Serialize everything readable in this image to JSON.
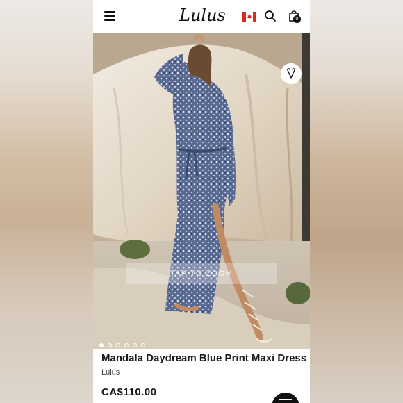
{
  "header": {
    "logo_text": "Lulus",
    "cart_count": "0",
    "icons": [
      "hamburger-menu-icon",
      "canada-flag-icon",
      "search-icon",
      "shopping-bag-icon"
    ]
  },
  "gallery": {
    "overlay_text": "TAP TO ZOOM",
    "image_count": 6,
    "active_index": 0,
    "wishlist_icon": "heart-v-icon"
  },
  "product": {
    "title": "Mandala Daydream Blue Print Maxi Dress",
    "brand": "Lulus",
    "price": "CA$110.00"
  },
  "colors": {
    "text": "#1a1a1a",
    "dress": "#4e5f86",
    "backdrop": "#e6ddcf"
  }
}
